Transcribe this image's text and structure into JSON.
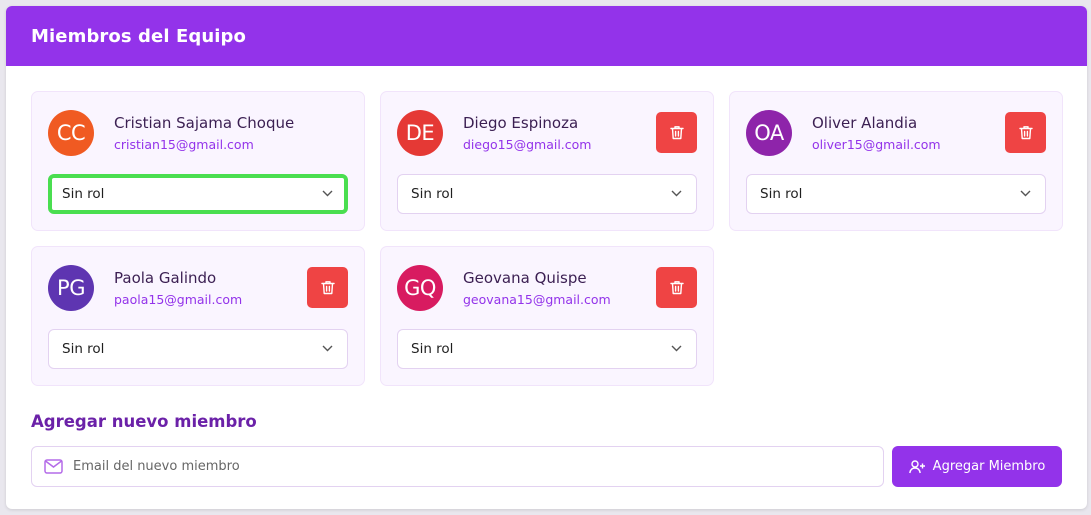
{
  "header": {
    "title": "Miembros del Equipo"
  },
  "members": [
    {
      "initials": "CC",
      "name": "Cristian Sajama Choque",
      "email": "cristian15@gmail.com",
      "role": "Sin rol",
      "avatar_color": "#f05a22",
      "deletable": false
    },
    {
      "initials": "DE",
      "name": "Diego Espinoza",
      "email": "diego15@gmail.com",
      "role": "Sin rol",
      "avatar_color": "#e53935",
      "deletable": true
    },
    {
      "initials": "OA",
      "name": "Oliver Alandia",
      "email": "oliver15@gmail.com",
      "role": "Sin rol",
      "avatar_color": "#8e24aa",
      "deletable": true
    },
    {
      "initials": "PG",
      "name": "Paola Galindo",
      "email": "paola15@gmail.com",
      "role": "Sin rol",
      "avatar_color": "#5e35b1",
      "deletable": true
    },
    {
      "initials": "GQ",
      "name": "Geovana Quispe",
      "email": "geovana15@gmail.com",
      "role": "Sin rol",
      "avatar_color": "#d81b60",
      "deletable": true
    }
  ],
  "add_member": {
    "title": "Agregar nuevo miembro",
    "email_placeholder": "Email del nuevo miembro",
    "email_icon": "mail-icon",
    "button_label": "Agregar Miembro",
    "button_icon": "user-plus-icon"
  },
  "colors": {
    "accent": "#9333ea",
    "delete": "#ef4444",
    "focus_ring": "#4ade50"
  }
}
